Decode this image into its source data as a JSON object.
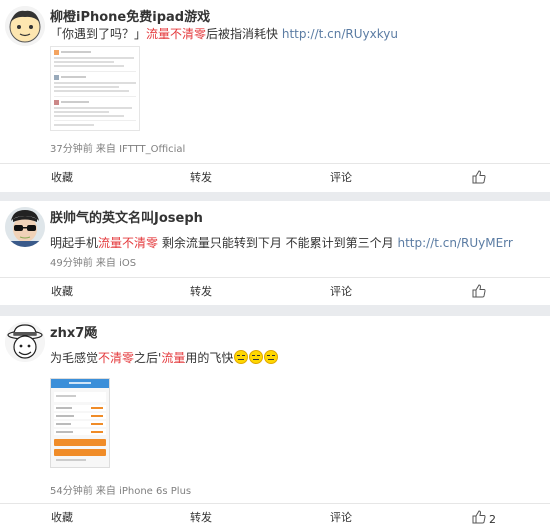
{
  "posts": [
    {
      "username": "柳橙iPhone免费ipad游戏",
      "text_pre": "「你遇到了吗？」",
      "text_red": "流量不清零",
      "text_post": "后被指消耗快 ",
      "link": "http://t.cn/RUyxkyu",
      "meta": "37分钟前 来自 IFTTT_Official"
    },
    {
      "username": "朕帅气的英文名叫Joseph",
      "text_pre": "明起手机",
      "text_red": "流量不清零",
      "text_post": " 剩余流量只能转到下月 不能累计到第三个月 ",
      "link": "http://t.cn/RUyMErr",
      "meta": "49分钟前 来自 iOS"
    },
    {
      "username": "zhx7飏",
      "text_pre": "为毛感觉",
      "text_red": "不清零",
      "text_mid": "之后",
      "text_quote": "'",
      "text_red2": "流量",
      "text_post": "用的飞快",
      "meta": "54分钟前 来自 iPhone 6s Plus",
      "like_count": "2"
    }
  ],
  "actions": {
    "favorite": "收藏",
    "repost": "转发",
    "comment": "评论"
  },
  "icons": [
    "thumbs-up-icon",
    "grin-emoji-icon"
  ],
  "colors": {
    "highlight_red": "#e4393c",
    "link_blue": "#5b7ca3",
    "meta_gray": "#808080"
  }
}
